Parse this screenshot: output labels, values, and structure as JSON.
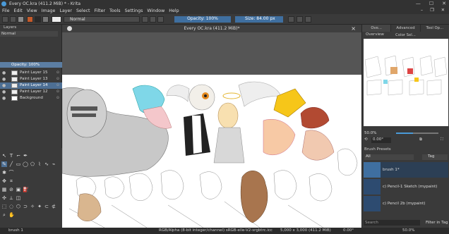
{
  "window": {
    "title": "Every OC.kra (411.2 MiB) * - Krita",
    "min": "—",
    "max": "☐",
    "close": "✕"
  },
  "menu": [
    "File",
    "Edit",
    "View",
    "Image",
    "Layer",
    "Select",
    "Filter",
    "Tools",
    "Settings",
    "Window",
    "Help"
  ],
  "toolbar": {
    "blend_mode": "Normal",
    "opacity_label": "Opacity: 100%",
    "size_label": "Size: 84.00 px"
  },
  "layers_docker": {
    "title": "Layers",
    "blend_mode": "Normal",
    "opacity": "Opacity: 100%",
    "layers": [
      {
        "name": "Paint Layer 15",
        "selected": false
      },
      {
        "name": "Paint Layer 13",
        "selected": false
      },
      {
        "name": "Paint Layer 14",
        "selected": true
      },
      {
        "name": "Paint Layer 12",
        "selected": false
      },
      {
        "name": "Background",
        "selected": false
      }
    ]
  },
  "document": {
    "tab_title": "Every OC.kra (411.2 MiB)*",
    "close": "×"
  },
  "right_docker": {
    "tabs": [
      "Ove...",
      "Advanced Color Sel...",
      "Tool Op..."
    ],
    "overview_title": "Overview",
    "zoom": "50.0%",
    "rotation": "0.00°",
    "presets_title": "Brush Presets",
    "filter_all": "All",
    "tag_label": "Tag",
    "presets": [
      {
        "name": "brush 1*",
        "selected": true
      },
      {
        "name": "c) Pencil-1 Sketch (mypaint)",
        "selected": false
      },
      {
        "name": "c) Pencil 2b (mypaint)",
        "selected": false
      }
    ],
    "search_placeholder": "Search",
    "filter_in_tag": "Filter in Tag"
  },
  "status": {
    "brush": "brush 1",
    "color_space": "RGB/Alpha (8-bit integer/channel)  sRGB-elle-V2-srgbtrc.icc",
    "dimensions": "5,000 x 3,000 (411.2 MiB)",
    "rotation": "0.00°",
    "zoom": "50.0%"
  }
}
